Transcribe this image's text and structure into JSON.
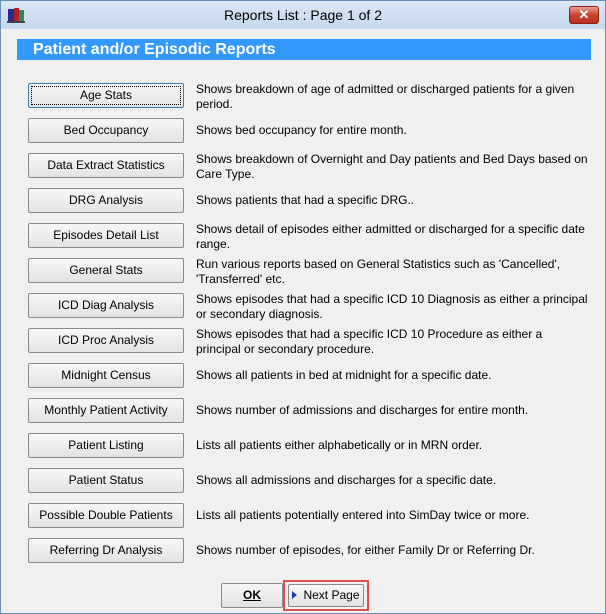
{
  "window": {
    "title": "Reports List : Page 1 of 2",
    "close_label": "✕"
  },
  "section": {
    "title": "Patient and/or Episodic Reports"
  },
  "reports": [
    {
      "label": "Age Stats",
      "desc": "Shows breakdown of age of admitted or discharged patients for a given period."
    },
    {
      "label": "Bed Occupancy",
      "desc": "Shows bed occupancy for entire month."
    },
    {
      "label": "Data Extract Statistics",
      "desc": "Shows breakdown of Overnight and Day patients and Bed Days based on Care Type."
    },
    {
      "label": "DRG Analysis",
      "desc": "Shows patients that had a specific DRG.."
    },
    {
      "label": "Episodes Detail List",
      "desc": "Shows detail of episodes either admitted or discharged for a specific date range."
    },
    {
      "label": "General Stats",
      "desc": "Run various reports based on General Statistics such as 'Cancelled', 'Transferred' etc."
    },
    {
      "label": "ICD Diag Analysis",
      "desc": "Shows episodes that had a specific ICD 10 Diagnosis as either a principal or secondary diagnosis."
    },
    {
      "label": "ICD Proc Analysis",
      "desc": "Shows episodes that had a specific ICD 10 Procedure as either a principal or secondary procedure."
    },
    {
      "label": "Midnight Census",
      "desc": "Shows all patients in bed at midnight for a specific date."
    },
    {
      "label": "Monthly Patient Activity",
      "desc": "Shows number of admissions and discharges for entire month."
    },
    {
      "label": "Patient Listing",
      "desc": "Lists all patients either alphabetically or in MRN order."
    },
    {
      "label": "Patient Status",
      "desc": "Shows all admissions and discharges for a specific date."
    },
    {
      "label": "Possible Double Patients",
      "desc": "Lists all patients potentially entered into SimDay twice or more."
    },
    {
      "label": "Referring Dr Analysis",
      "desc": "Shows number of episodes, for either Family Dr or Referring Dr."
    }
  ],
  "footer": {
    "ok_label": "OK",
    "next_label": "Next Page"
  },
  "colors": {
    "header_bg": "#3399ff",
    "highlight": "#d9534f"
  }
}
